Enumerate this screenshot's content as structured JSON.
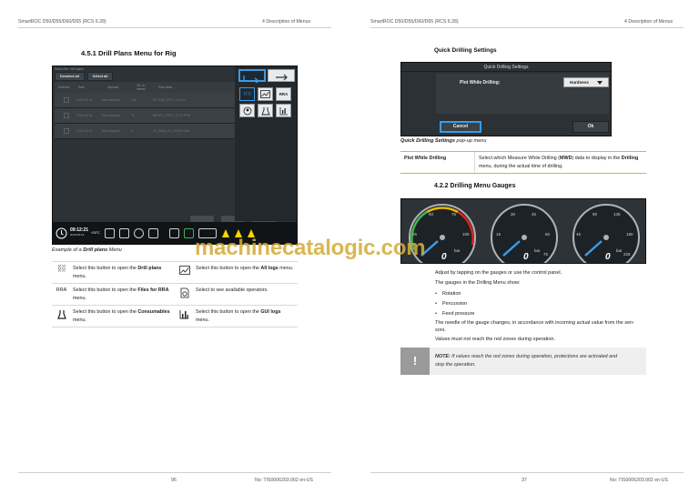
{
  "left_page": {
    "header_left": "SmartROC D50/D55/D60/D65 (RCS 6.28)",
    "header_right": "4 Description of Menus",
    "section_title": "4.5.1 Drill Plans Menu for Rig",
    "screenshot": {
      "top_hint": "Select file / drill plans",
      "deselect_label": "Deselect all",
      "select_label": "Select all",
      "columns": [
        "Selected",
        "Date",
        "Operator",
        "Tot. dr. metres",
        "Plan name"
      ],
      "rows": [
        [
          "2019-05-16",
          "Not assigned",
          "138",
          "ROT008_DRP_X15.xml"
        ],
        [
          "2019-05-16",
          "Not assigned",
          "78",
          "BENCH_TEST_2R_R.PRN"
        ],
        [
          "2019-05-16",
          "Not assigned",
          "0",
          "JP_SMALLR_19000K.XML"
        ]
      ],
      "side_icons": [
        "drill-plans",
        "all-logs",
        "RRA",
        "operators",
        "consumables",
        "gui-logs"
      ],
      "side_rra_label": "RRA",
      "clock": "09:12:21",
      "date": "2019-05-16",
      "temperature": "+20°C"
    },
    "caption_prefix": "Example of a ",
    "caption_bold": "Drill plans",
    "caption_suffix": " Menu",
    "table": [
      {
        "left_icon": "dots-grid",
        "left_pre": "Select this button to open the ",
        "left_bold": "Drill plans",
        "left_post": " menu.",
        "right_icon": "chart",
        "right_pre": "Select this button to open the ",
        "right_bold": "All logs",
        "right_post": " menu."
      },
      {
        "left_icon": "RRA",
        "left_pre": "Select this button to open the ",
        "left_bold": "Files for RRA",
        "left_post": " menu.",
        "right_icon": "operator",
        "right_pre": "Select to see available operators.",
        "right_bold": "",
        "right_post": ""
      },
      {
        "left_icon": "flask",
        "left_pre": "Select this button to open the ",
        "left_bold": "Consumables",
        "left_post": " menu.",
        "right_icon": "bar-chart",
        "right_pre": "Select this button to open the ",
        "right_bold": "GUI logs",
        "right_post": " menu."
      }
    ],
    "footer_page": "96",
    "footer_doc": "No: TIS0006203.002 en-US"
  },
  "right_page": {
    "header_left": "SmartROC D50/D55/D60/D65 (RCS 6.28)",
    "header_right": "4 Description of Menus",
    "quick_title": "Quick Drilling Settings",
    "dialog": {
      "title": "Quick Drilling Settings",
      "label": "Plot While Drilling:",
      "value": "Hardness",
      "cancel": "Cancel",
      "ok": "Ok"
    },
    "popup_caption_bold": "Quick Drilling Settings",
    "popup_caption_rest": " pop-up menu",
    "table_label": "Plot While Drilling",
    "table_desc_1": "Select which Measure While Drilling (",
    "table_desc_bold1": "MWD",
    "table_desc_2": ") data to display in the ",
    "table_desc_bold2": "Drilling",
    "table_desc_3": " menu, during the actual time of drilling.",
    "gauges_title": "4.2.2 Drilling Menu Gauges",
    "gauges": [
      {
        "value": "0",
        "unit": "bar",
        "ticks": [
          "25",
          "50",
          "75",
          "100"
        ]
      },
      {
        "value": "0",
        "unit": "bar",
        "ticks": [
          "15",
          "30",
          "45",
          "60",
          "75"
        ]
      },
      {
        "value": "0",
        "unit": "bar",
        "ticks": [
          "45",
          "90",
          "135",
          "180",
          "225"
        ]
      }
    ],
    "para1": "Adjust by tapping on the gauges or use the control panel.",
    "para2": "The gauges in the Drilling Menu show:",
    "bullets": [
      "Rotation",
      "Percussion",
      "Feed pressure"
    ],
    "para3a": "The needle of the gauge changes, in accordance with incoming actual value from the sen-",
    "para3b": "sors.",
    "para4": "Values must not reach the red zones during operation.",
    "note_label": "NOTE:",
    "note_text_a": " If values reach the red zones during operation, protections are activated and",
    "note_text_b": "stop the operation.",
    "note_mark": "!",
    "footer_page": "37",
    "footer_doc": "No: TIS0006203.002 en-US"
  },
  "watermark": "machinecatalogic.com"
}
